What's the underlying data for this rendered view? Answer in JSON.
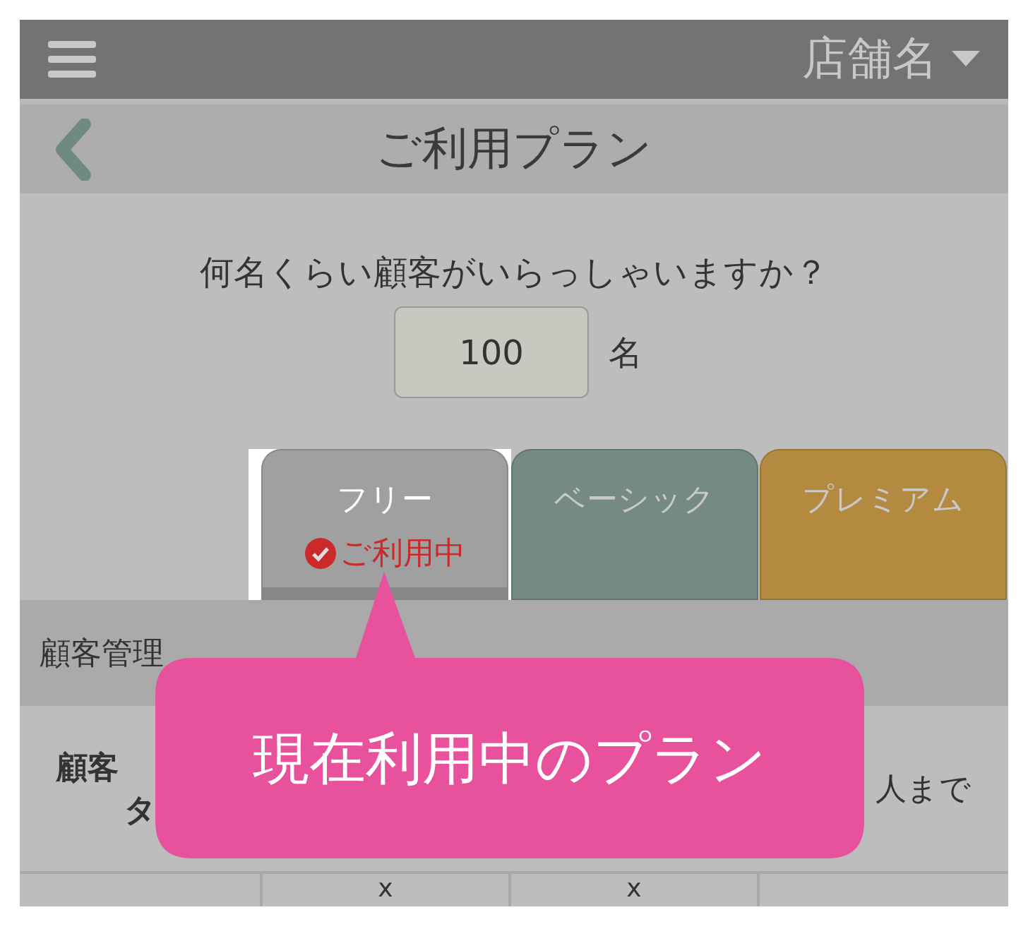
{
  "top_bar": {
    "store_name": "店舗名"
  },
  "header": {
    "title": "ご利用プラン"
  },
  "question": {
    "text": "何名くらい顧客がいらっしゃいますか？",
    "value": "100",
    "unit": "名"
  },
  "plans": [
    {
      "label": "フリー",
      "selected": true,
      "status": "ご利用中",
      "color": "#a0a0a0"
    },
    {
      "label": "ベーシック",
      "selected": false,
      "color": "#748a82"
    },
    {
      "label": "プレミアム",
      "selected": false,
      "color": "#b38a40"
    }
  ],
  "section": {
    "title": "顧客管理"
  },
  "rows": [
    {
      "label_lines": [
        "顧客",
        "タ"
      ],
      "cells": [
        null,
        null,
        "人まで"
      ]
    },
    {
      "cells": [
        "x",
        "x",
        null
      ]
    }
  ],
  "callout": {
    "text": "現在利用中のプラン"
  }
}
